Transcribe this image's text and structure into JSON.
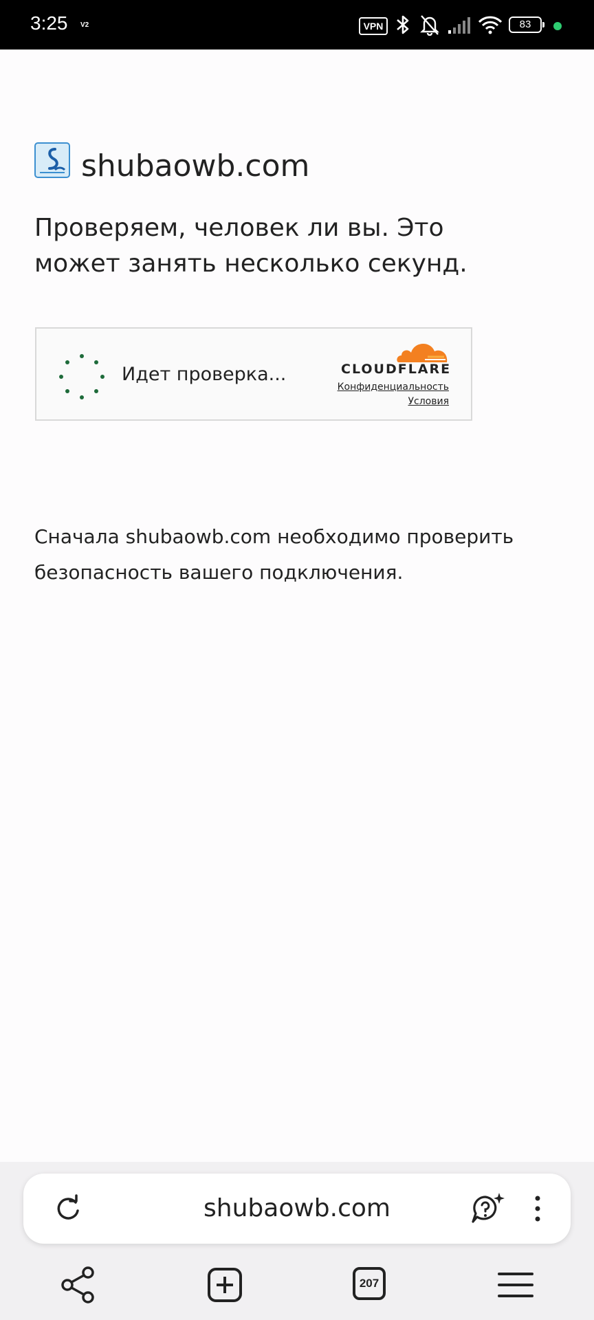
{
  "status_bar": {
    "time": "3:25",
    "network_tag": "V2",
    "vpn_label": "VPN",
    "battery": "83",
    "indicator_color": "#2ecc71"
  },
  "page": {
    "site_name": "shubaowb.com",
    "heading": "Проверяем, человек ли вы. Это может занять несколько секунд.",
    "description": "Сначала shubaowb.com необходимо проверить безопасность вашего подключения."
  },
  "challenge": {
    "status": "Идет проверка...",
    "brand": "CLOUDFLARE",
    "privacy_link": "Конфиденциальность",
    "terms_link": "Условия",
    "spinner_color": "#1e6b3a",
    "brand_color": "#f38020"
  },
  "browser": {
    "url": "shubaowb.com",
    "tab_count": "207"
  },
  "icons": {
    "reload": "reload-icon",
    "assistant": "assistant-icon",
    "more": "more-vertical-icon",
    "share": "share-icon",
    "new_tab": "new-tab-icon",
    "tabs": "tabs-icon",
    "menu": "menu-icon"
  }
}
